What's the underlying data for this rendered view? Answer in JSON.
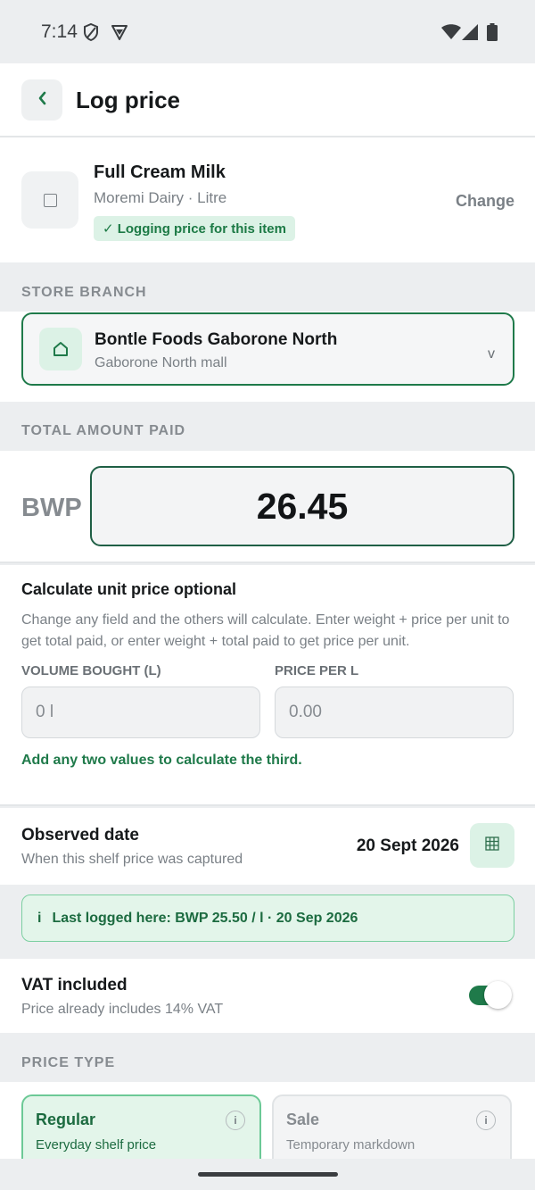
{
  "status_bar": {
    "time": "7:14"
  },
  "header": {
    "back_icon": "chevron-left-icon",
    "title": "Log price"
  },
  "product": {
    "name": "Full Cream Milk",
    "subtitle": "Moremi Dairy · Litre",
    "badge": "✓ Logging price for this item",
    "change_label": "Change"
  },
  "store_branch": {
    "section_label": "STORE BRANCH",
    "name": "Bontle Foods Gaborone North",
    "location": "Gaborone North mall",
    "chevron": "v"
  },
  "total_amount": {
    "section_label": "TOTAL AMOUNT PAID",
    "currency": "BWP",
    "value": "26.45"
  },
  "unit_calc": {
    "title": "Calculate unit price optional",
    "description": "Change any field and the others will calculate. Enter weight + price per unit to get total paid, or enter weight + total paid to get price per unit.",
    "volume_label": "VOLUME BOUGHT (L)",
    "volume_placeholder": "0 l",
    "price_label": "PRICE PER L",
    "price_placeholder": "0.00",
    "hint": "Add any two values to calculate the third."
  },
  "observed_date": {
    "title": "Observed date",
    "subtitle": "When this shelf price was captured",
    "value": "20 Sept 2026"
  },
  "last_logged": {
    "icon": "i",
    "text": "Last logged here: BWP 25.50 / l · 20 Sep 2026"
  },
  "vat": {
    "title": "VAT included",
    "subtitle": "Price already includes 14% VAT",
    "enabled": true
  },
  "price_type": {
    "section_label": "PRICE TYPE",
    "options": [
      {
        "label": "Regular",
        "description": "Everyday shelf price",
        "selected": true
      },
      {
        "label": "Sale",
        "description": "Temporary markdown",
        "selected": false
      }
    ]
  },
  "colors": {
    "accent": "#1f7a4a",
    "accent_light": "#dcf2e6",
    "background": "#eceef0",
    "muted_text": "#7a8086"
  }
}
